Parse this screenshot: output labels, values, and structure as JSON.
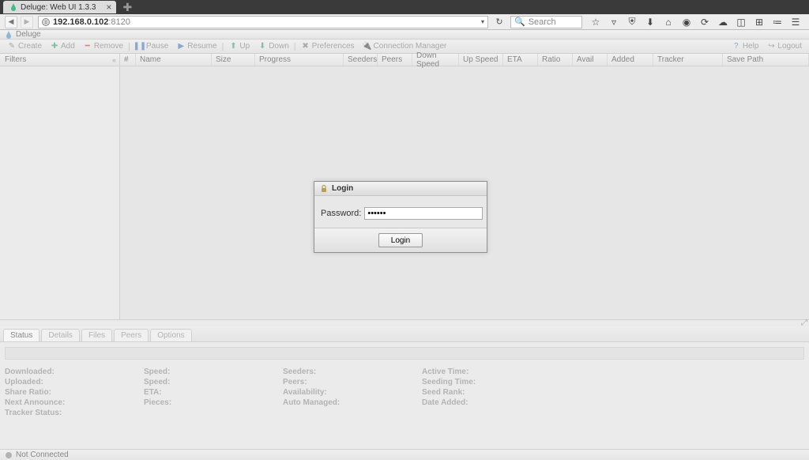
{
  "browser": {
    "tab_title": "Deluge: Web UI 1.3.3",
    "address_host": "192.168.0.102",
    "address_port": ":8120",
    "search_placeholder": "Search"
  },
  "app": {
    "title": "Deluge"
  },
  "toolbar": {
    "create": "Create",
    "add": "Add",
    "remove": "Remove",
    "pause": "Pause",
    "resume": "Resume",
    "up": "Up",
    "down": "Down",
    "preferences": "Preferences",
    "connection_manager": "Connection Manager",
    "help": "Help",
    "logout": "Logout"
  },
  "sidebar": {
    "filters": "Filters"
  },
  "columns": {
    "num": "#",
    "name": "Name",
    "size": "Size",
    "progress": "Progress",
    "seeders": "Seeders",
    "peers": "Peers",
    "down_speed": "Down Speed",
    "up_speed": "Up Speed",
    "eta": "ETA",
    "ratio": "Ratio",
    "avail": "Avail",
    "added": "Added",
    "tracker": "Tracker",
    "save_path": "Save Path"
  },
  "tabs": {
    "status": "Status",
    "details": "Details",
    "files": "Files",
    "peers": "Peers",
    "options": "Options"
  },
  "status_fields": {
    "downloaded": "Downloaded:",
    "uploaded": "Uploaded:",
    "share_ratio": "Share Ratio:",
    "next_announce": "Next Announce:",
    "tracker_status": "Tracker Status:",
    "speed1": "Speed:",
    "speed2": "Speed:",
    "eta": "ETA:",
    "pieces": "Pieces:",
    "seeders": "Seeders:",
    "peers": "Peers:",
    "availability": "Availability:",
    "auto_managed": "Auto Managed:",
    "active_time": "Active Time:",
    "seeding_time": "Seeding Time:",
    "seed_rank": "Seed Rank:",
    "date_added": "Date Added:"
  },
  "statusbar": {
    "not_connected": "Not Connected"
  },
  "modal": {
    "title": "Login",
    "password_label": "Password:",
    "password_value": "••••••",
    "login_button": "Login"
  }
}
